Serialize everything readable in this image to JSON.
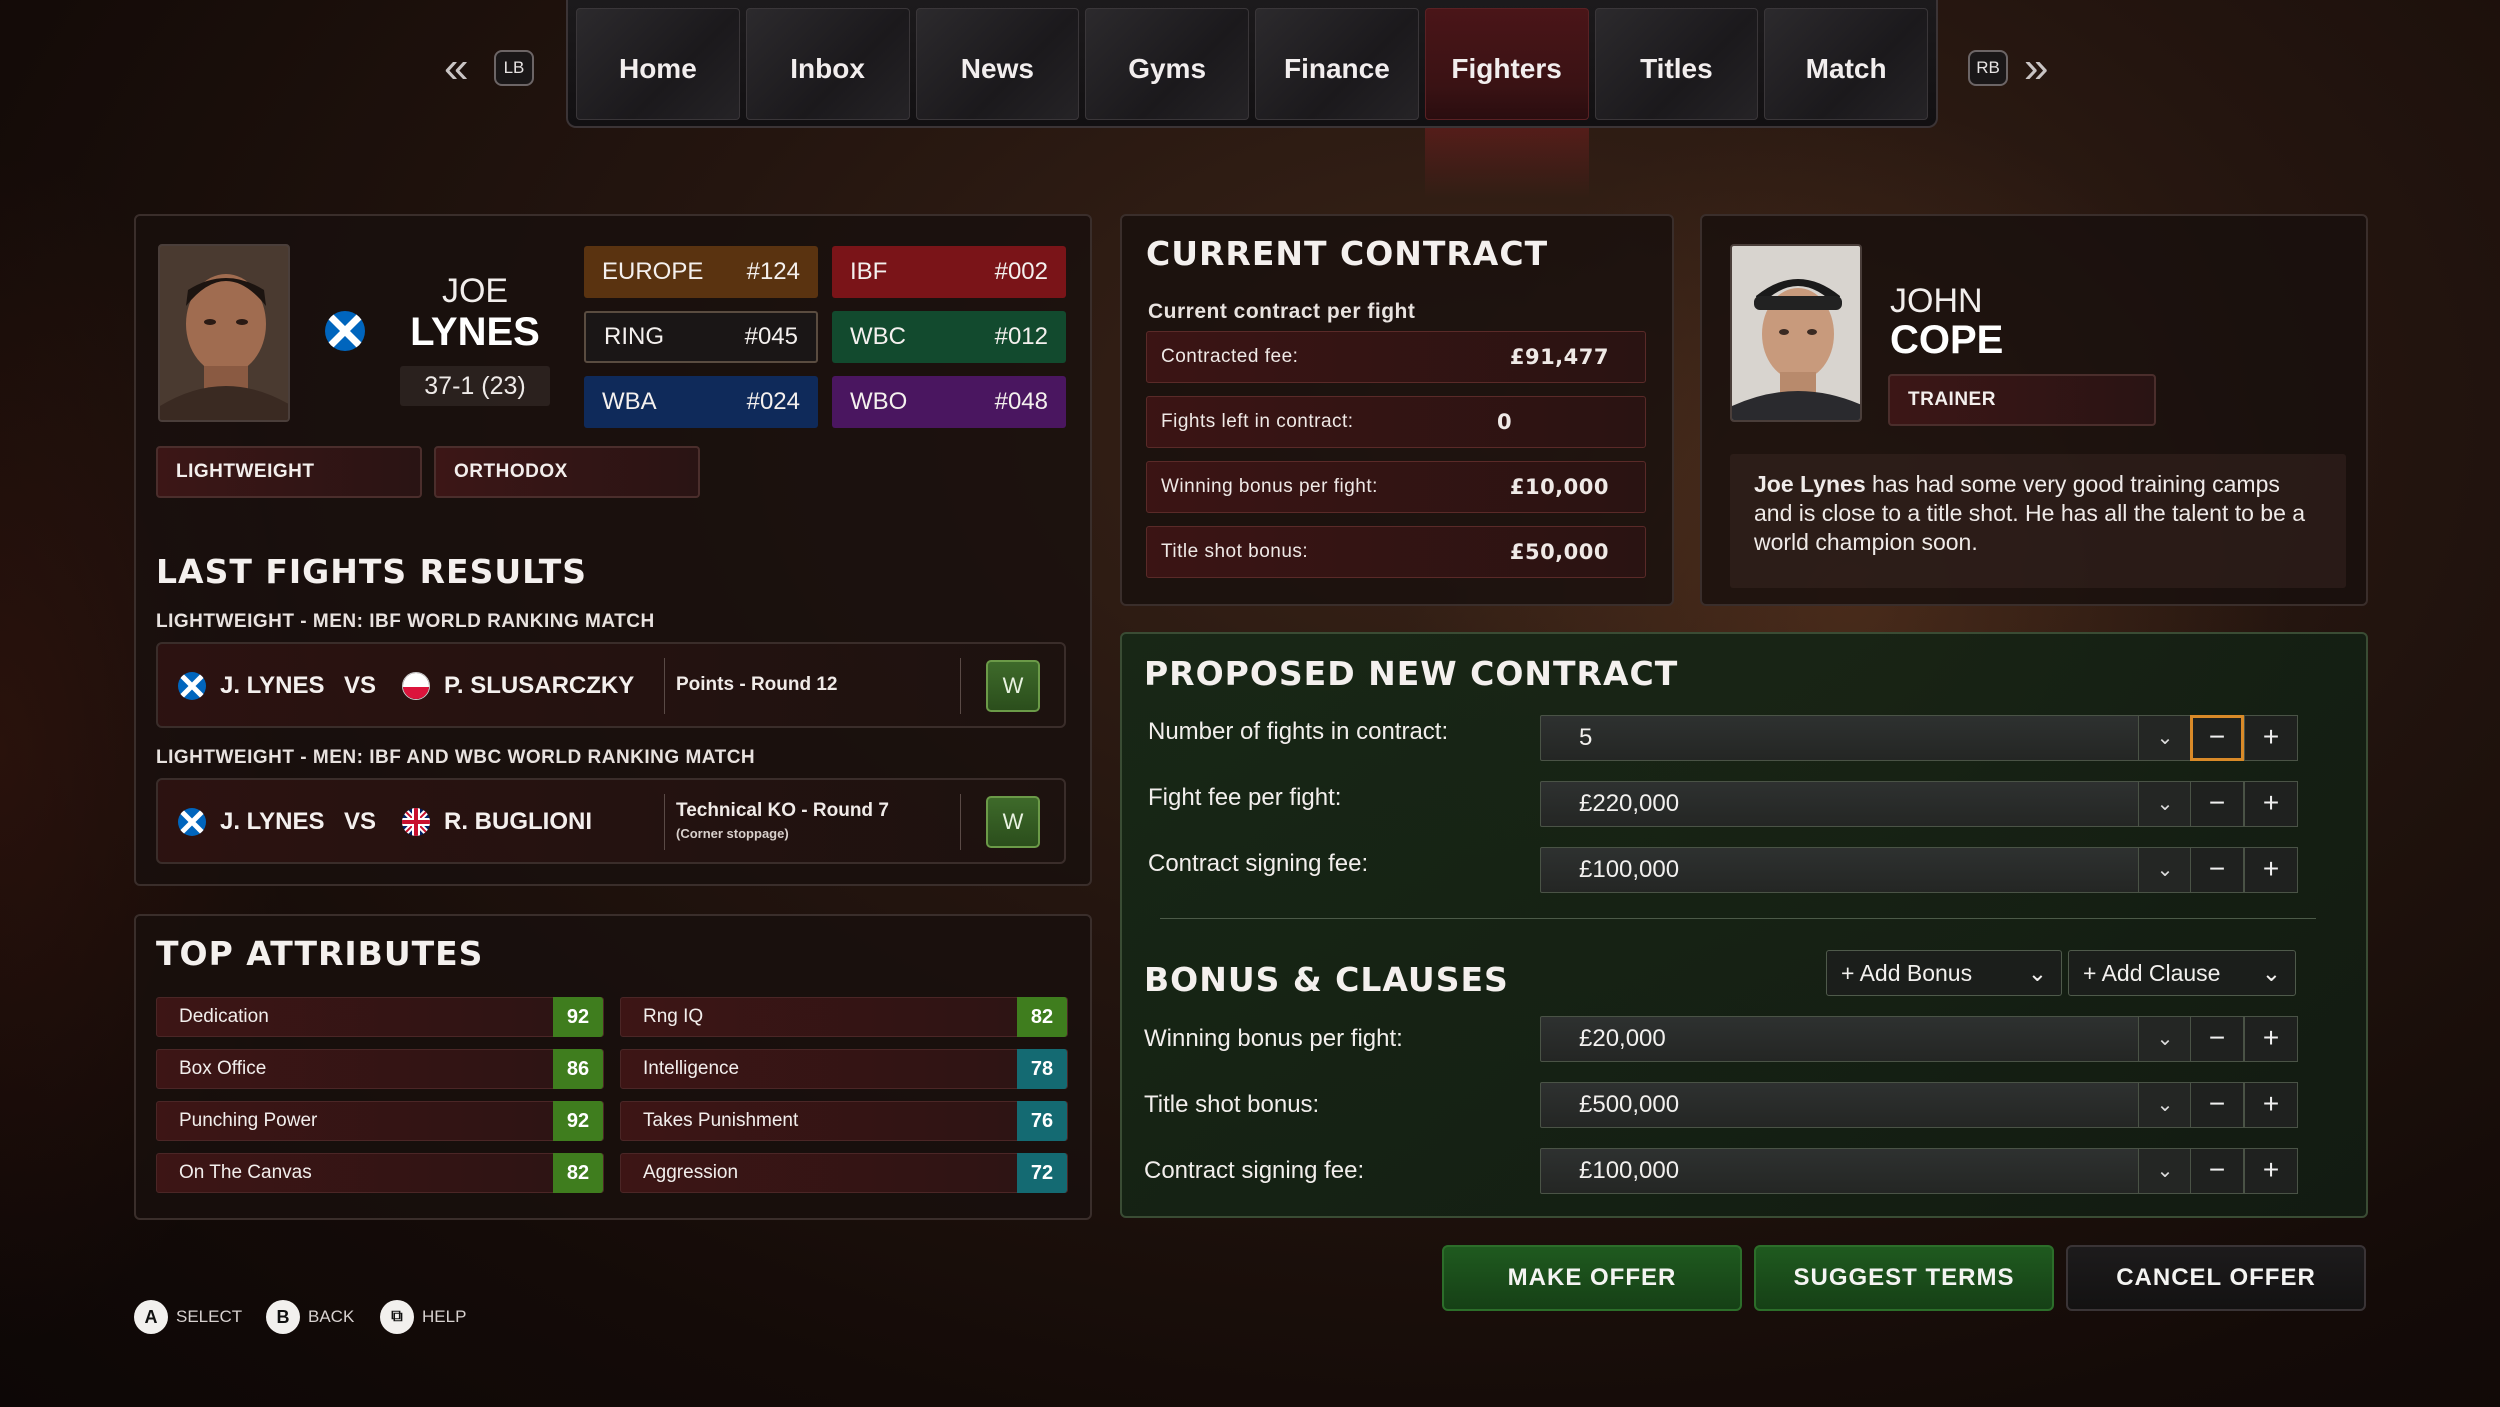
{
  "nav": {
    "left_shoulder": "LB",
    "right_shoulder": "RB",
    "tabs": [
      {
        "label": "Home"
      },
      {
        "label": "Inbox"
      },
      {
        "label": "News"
      },
      {
        "label": "Gyms"
      },
      {
        "label": "Finance"
      },
      {
        "label": "Fighters"
      },
      {
        "label": "Titles"
      },
      {
        "label": "Match"
      }
    ],
    "active_tab": "Fighters"
  },
  "fighter": {
    "first_name": "JOE",
    "last_name": "LYNES",
    "record": "37-1 (23)",
    "weight_class": "LIGHTWEIGHT",
    "stance": "ORTHODOX",
    "rankings": [
      {
        "name": "EUROPE",
        "rank": "#124",
        "color": "#5a3310"
      },
      {
        "name": "IBF",
        "rank": "#002",
        "color": "#7a1418"
      },
      {
        "name": "RING",
        "rank": "#045",
        "color": "#1a1616"
      },
      {
        "name": "WBC",
        "rank": "#012",
        "color": "#124a2e"
      },
      {
        "name": "WBA",
        "rank": "#024",
        "color": "#0f2a5a"
      },
      {
        "name": "WBO",
        "rank": "#048",
        "color": "#4a1660"
      }
    ]
  },
  "last_fights": {
    "title": "LAST FIGHTS RESULTS",
    "fights": [
      {
        "heading": "LIGHTWEIGHT - MEN: IBF WORLD RANKING MATCH",
        "fighter_a": "J. LYNES",
        "vs": "VS",
        "fighter_b": "P. SLUSARCZKY",
        "method": "Points - Round 12",
        "method_note": "",
        "result": "W"
      },
      {
        "heading": "LIGHTWEIGHT - MEN: IBF AND WBC WORLD RANKING MATCH",
        "fighter_a": "J. LYNES",
        "vs": "VS",
        "fighter_b": "R. BUGLIONI",
        "method": "Technical KO - Round 7",
        "method_note": "(Corner stoppage)",
        "result": "W"
      }
    ]
  },
  "attributes": {
    "title": "TOP ATTRIBUTES",
    "items": [
      {
        "name": "Dedication",
        "value": "92",
        "color": "#3f7d1e"
      },
      {
        "name": "Rng IQ",
        "value": "82",
        "color": "#3f7d1e"
      },
      {
        "name": "Box Office",
        "value": "86",
        "color": "#3f7d1e"
      },
      {
        "name": "Intelligence",
        "value": "78",
        "color": "#146a72"
      },
      {
        "name": "Punching Power",
        "value": "92",
        "color": "#3f7d1e"
      },
      {
        "name": "Takes Punishment",
        "value": "76",
        "color": "#146a72"
      },
      {
        "name": "On The Canvas",
        "value": "82",
        "color": "#3f7d1e"
      },
      {
        "name": "Aggression",
        "value": "72",
        "color": "#146a72"
      }
    ]
  },
  "current_contract": {
    "title": "CURRENT CONTRACT",
    "subtitle": "Current contract per fight",
    "rows": [
      {
        "label": "Contracted fee:",
        "value": "£91,477"
      },
      {
        "label": "Fights left in contract:",
        "value": "0"
      },
      {
        "label": "Winning bonus per fight:",
        "value": "£10,000"
      },
      {
        "label": "Title shot bonus:",
        "value": "£50,000"
      }
    ]
  },
  "trainer": {
    "first_name": "JOHN",
    "last_name": "COPE",
    "role": "TRAINER",
    "quote_name": "Joe Lynes",
    "quote_text": " has had some very good training camps and is close to a title shot. He has all the talent to be a world champion soon."
  },
  "proposed": {
    "title": "PROPOSED NEW CONTRACT",
    "fields": [
      {
        "label": "Number of fights in contract:",
        "value": "5"
      },
      {
        "label": "Fight fee per fight:",
        "value": "£220,000"
      },
      {
        "label": "Contract signing fee:",
        "value": "£100,000"
      }
    ],
    "bonus_title": "BONUS & CLAUSES",
    "add_bonus": "Add Bonus",
    "add_clause": "Add Clause",
    "bonus_fields": [
      {
        "label": "Winning bonus per fight:",
        "value": "£20,000"
      },
      {
        "label": "Title shot bonus:",
        "value": "£500,000"
      },
      {
        "label": "Contract signing fee:",
        "value": "£100,000"
      }
    ]
  },
  "actions": {
    "make_offer": "MAKE OFFER",
    "suggest_terms": "SUGGEST TERMS",
    "cancel_offer": "CANCEL OFFER"
  },
  "hints": [
    {
      "key": "A",
      "label": "SELECT"
    },
    {
      "key": "B",
      "label": "BACK"
    },
    {
      "key": "⧉",
      "label": "HELP"
    }
  ]
}
